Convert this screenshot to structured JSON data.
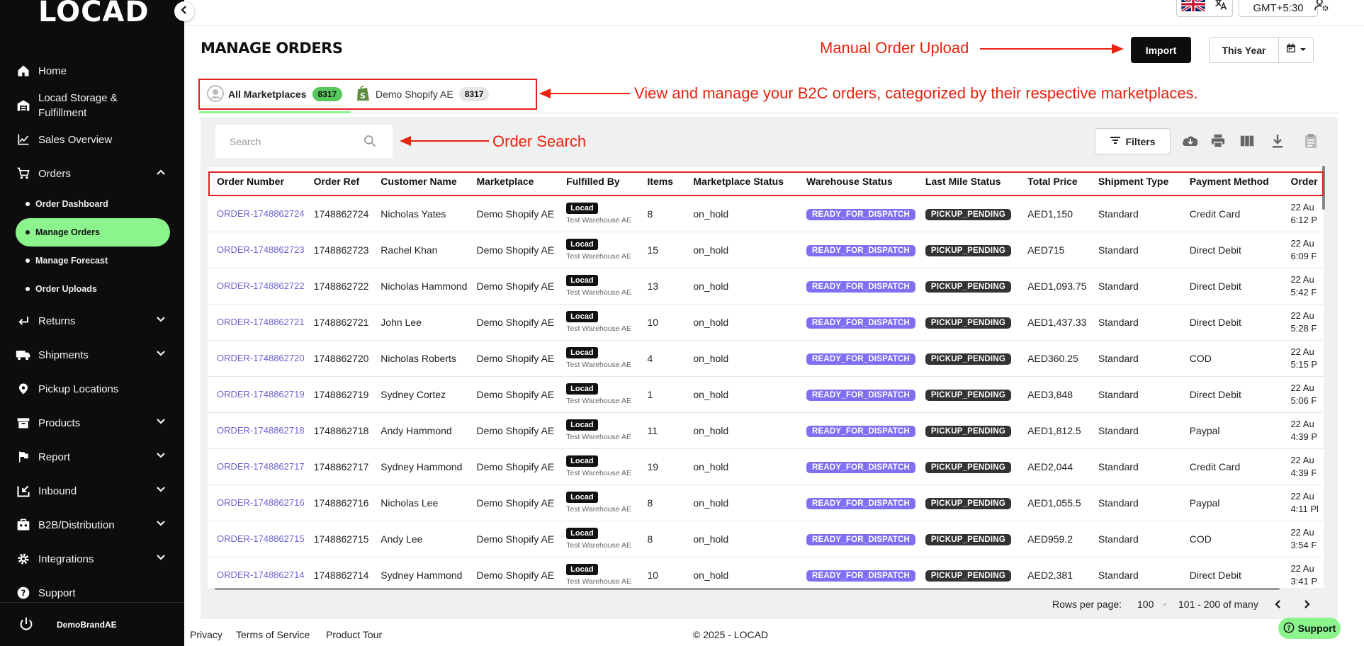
{
  "app": {
    "logo": "LOCAD"
  },
  "sidebar": {
    "items": [
      {
        "label": "Home",
        "icon": "home-icon"
      },
      {
        "label": "Locad Storage &",
        "label2": "Fulfillment",
        "icon": "warehouse-icon"
      },
      {
        "label": "Sales Overview",
        "icon": "chart-icon"
      },
      {
        "label": "Orders",
        "icon": "cart-icon"
      },
      {
        "label": "Returns",
        "icon": "return-icon"
      },
      {
        "label": "Shipments",
        "icon": "truck-icon"
      },
      {
        "label": "Pickup Locations",
        "icon": "location-pin-icon"
      },
      {
        "label": "Products",
        "icon": "box-icon"
      },
      {
        "label": "Report",
        "icon": "flag-icon"
      },
      {
        "label": "Inbound",
        "icon": "inbound-icon"
      },
      {
        "label": "B2B/Distribution",
        "icon": "distribution-icon"
      },
      {
        "label": "Integrations",
        "icon": "gear-icon"
      },
      {
        "label": "Support",
        "icon": "help-icon"
      }
    ],
    "orders_sub": [
      "Order Dashboard",
      "Manage Orders",
      "Manage Forecast",
      "Order Uploads"
    ],
    "user": "DemoBrandAE"
  },
  "topbar": {
    "timezone": "GMT+5:30"
  },
  "page": {
    "title": "MANAGE ORDERS",
    "import_label": "Import",
    "period_label": "This Year",
    "search_placeholder": "Search",
    "filters_label": "Filters"
  },
  "annotations": {
    "upload": "Manual Order Upload",
    "marketplaces": "View and manage your B2C orders, categorized by their respective marketplaces.",
    "search": "Order Search"
  },
  "tabs": [
    {
      "label": "All Marketplaces",
      "count": "8317"
    },
    {
      "label": "Demo Shopify AE",
      "count": "8317"
    }
  ],
  "table": {
    "headers": [
      "Order Number",
      "Order Ref",
      "Customer Name",
      "Marketplace",
      "Fulfilled By",
      "Items",
      "Marketplace Status",
      "Warehouse Status",
      "Last Mile Status",
      "Total Price",
      "Shipment Type",
      "Payment Method",
      "Order"
    ],
    "rows": [
      {
        "order": "ORDER-1748862724",
        "ref": "1748862724",
        "customer": "Nicholas Yates",
        "marketplace": "Demo Shopify AE",
        "fulfiller": "Locad",
        "warehouse": "Test Warehouse AE",
        "items": "8",
        "mp_status": "on_hold",
        "wh_status": "READY_FOR_DISPATCH",
        "lm_status": "PICKUP_PENDING",
        "price": "AED1,150",
        "shipment": "Standard",
        "payment": "Credit Card",
        "date": "22 Au",
        "time": "6:12 P"
      },
      {
        "order": "ORDER-1748862723",
        "ref": "1748862723",
        "customer": "Rachel Khan",
        "marketplace": "Demo Shopify AE",
        "fulfiller": "Locad",
        "warehouse": "Test Warehouse AE",
        "items": "15",
        "mp_status": "on_hold",
        "wh_status": "READY_FOR_DISPATCH",
        "lm_status": "PICKUP_PENDING",
        "price": "AED715",
        "shipment": "Standard",
        "payment": "Direct Debit",
        "date": "22 Au",
        "time": "6:09 F"
      },
      {
        "order": "ORDER-1748862722",
        "ref": "1748862722",
        "customer": "Nicholas Hammond",
        "marketplace": "Demo Shopify AE",
        "fulfiller": "Locad",
        "warehouse": "Test Warehouse AE",
        "items": "13",
        "mp_status": "on_hold",
        "wh_status": "READY_FOR_DISPATCH",
        "lm_status": "PICKUP_PENDING",
        "price": "AED1,093.75",
        "shipment": "Standard",
        "payment": "Direct Debit",
        "date": "22 Au",
        "time": "5:42 F"
      },
      {
        "order": "ORDER-1748862721",
        "ref": "1748862721",
        "customer": "John Lee",
        "marketplace": "Demo Shopify AE",
        "fulfiller": "Locad",
        "warehouse": "Test Warehouse AE",
        "items": "10",
        "mp_status": "on_hold",
        "wh_status": "READY_FOR_DISPATCH",
        "lm_status": "PICKUP_PENDING",
        "price": "AED1,437.33",
        "shipment": "Standard",
        "payment": "Direct Debit",
        "date": "22 Au",
        "time": "5:28 F"
      },
      {
        "order": "ORDER-1748862720",
        "ref": "1748862720",
        "customer": "Nicholas Roberts",
        "marketplace": "Demo Shopify AE",
        "fulfiller": "Locad",
        "warehouse": "Test Warehouse AE",
        "items": "4",
        "mp_status": "on_hold",
        "wh_status": "READY_FOR_DISPATCH",
        "lm_status": "PICKUP_PENDING",
        "price": "AED360.25",
        "shipment": "Standard",
        "payment": "COD",
        "date": "22 Au",
        "time": "5:15 P"
      },
      {
        "order": "ORDER-1748862719",
        "ref": "1748862719",
        "customer": "Sydney Cortez",
        "marketplace": "Demo Shopify AE",
        "fulfiller": "Locad",
        "warehouse": "Test Warehouse AE",
        "items": "1",
        "mp_status": "on_hold",
        "wh_status": "READY_FOR_DISPATCH",
        "lm_status": "PICKUP_PENDING",
        "price": "AED3,848",
        "shipment": "Standard",
        "payment": "Direct Debit",
        "date": "22 Au",
        "time": "5:06 F"
      },
      {
        "order": "ORDER-1748862718",
        "ref": "1748862718",
        "customer": "Andy Hammond",
        "marketplace": "Demo Shopify AE",
        "fulfiller": "Locad",
        "warehouse": "Test Warehouse AE",
        "items": "11",
        "mp_status": "on_hold",
        "wh_status": "READY_FOR_DISPATCH",
        "lm_status": "PICKUP_PENDING",
        "price": "AED1,812.5",
        "shipment": "Standard",
        "payment": "Paypal",
        "date": "22 Au",
        "time": "4:39 P"
      },
      {
        "order": "ORDER-1748862717",
        "ref": "1748862717",
        "customer": "Sydney Hammond",
        "marketplace": "Demo Shopify AE",
        "fulfiller": "Locad",
        "warehouse": "Test Warehouse AE",
        "items": "19",
        "mp_status": "on_hold",
        "wh_status": "READY_FOR_DISPATCH",
        "lm_status": "PICKUP_PENDING",
        "price": "AED2,044",
        "shipment": "Standard",
        "payment": "Credit Card",
        "date": "22 Au",
        "time": "4:39 F"
      },
      {
        "order": "ORDER-1748862716",
        "ref": "1748862716",
        "customer": "Nicholas Lee",
        "marketplace": "Demo Shopify AE",
        "fulfiller": "Locad",
        "warehouse": "Test Warehouse AE",
        "items": "8",
        "mp_status": "on_hold",
        "wh_status": "READY_FOR_DISPATCH",
        "lm_status": "PICKUP_PENDING",
        "price": "AED1,055.5",
        "shipment": "Standard",
        "payment": "Paypal",
        "date": "22 Au",
        "time": "4:11 Pl"
      },
      {
        "order": "ORDER-1748862715",
        "ref": "1748862715",
        "customer": "Andy Lee",
        "marketplace": "Demo Shopify AE",
        "fulfiller": "Locad",
        "warehouse": "Test Warehouse AE",
        "items": "8",
        "mp_status": "on_hold",
        "wh_status": "READY_FOR_DISPATCH",
        "lm_status": "PICKUP_PENDING",
        "price": "AED959.2",
        "shipment": "Standard",
        "payment": "COD",
        "date": "22 Au",
        "time": "3:54 F"
      },
      {
        "order": "ORDER-1748862714",
        "ref": "1748862714",
        "customer": "Sydney Hammond",
        "marketplace": "Demo Shopify AE",
        "fulfiller": "Locad",
        "warehouse": "Test Warehouse AE",
        "items": "10",
        "mp_status": "on_hold",
        "wh_status": "READY_FOR_DISPATCH",
        "lm_status": "PICKUP_PENDING",
        "price": "AED2,381",
        "shipment": "Standard",
        "payment": "Direct Debit",
        "date": "22 Au",
        "time": "3:41 P"
      }
    ]
  },
  "pagination": {
    "rows_label": "Rows per page:",
    "rows_value": "100",
    "range": "101 - 200 of many"
  },
  "footer": {
    "privacy": "Privacy",
    "terms": "Terms of Service",
    "tour": "Product Tour",
    "copyright": "© 2025 - LOCAD"
  },
  "support_button": "Support",
  "colors": {
    "accent_green": "#8cf48c",
    "annotation_red": "#e8230f",
    "link_purple": "#6b63cf",
    "status_purple": "#7f6ff2",
    "sidebar_bg": "#0d0d0d"
  }
}
